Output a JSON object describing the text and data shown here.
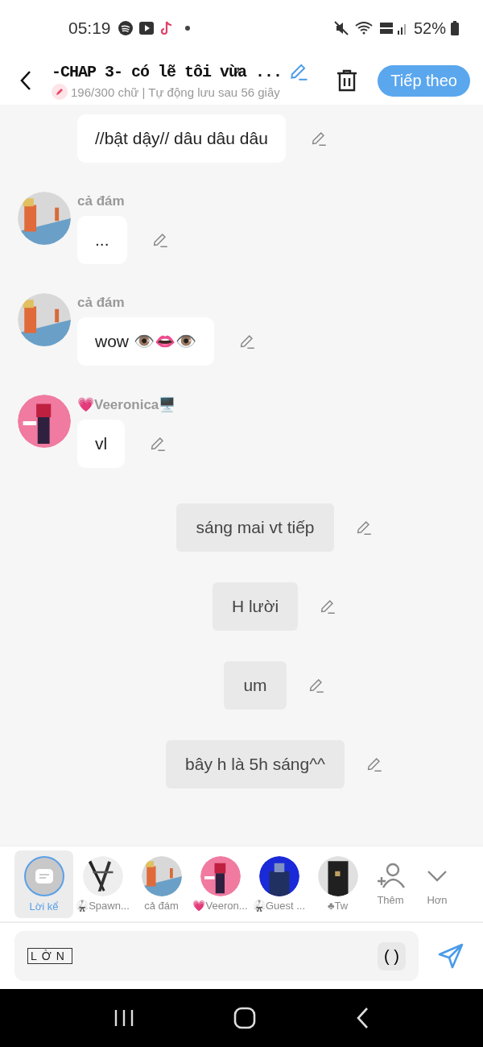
{
  "status_bar": {
    "time": "05:19",
    "battery": "52%"
  },
  "header": {
    "title": "-CHAP 3- có lẽ tôi vừa ...",
    "subtitle": "196/300 chữ | Tự động lưu sau 56 giây",
    "next_button": "Tiếp theo"
  },
  "messages": [
    {
      "kind": "character",
      "text": "//bật dậy// dâu dâu dâu"
    },
    {
      "kind": "character",
      "name": "cả đám",
      "text": "...",
      "avatar": {
        "kind": "hallway"
      }
    },
    {
      "kind": "character",
      "name": "cả đám",
      "text": "wow  👁️👄👁️",
      "avatar": {
        "kind": "hallway"
      }
    },
    {
      "kind": "character",
      "name": "💗Veeronica🖥️",
      "text": "vl",
      "avatar": {
        "kind": "pink"
      }
    },
    {
      "kind": "narration",
      "text": "sáng mai vt tiếp"
    },
    {
      "kind": "narration",
      "text": "H lười"
    },
    {
      "kind": "narration",
      "text": "um"
    },
    {
      "kind": "narration",
      "text": "bây h là 5h sáng^^"
    }
  ],
  "characters": [
    {
      "kind": "narrator",
      "label": "Lời kể",
      "selected": true
    },
    {
      "kind": "sketch",
      "label": "🥋Spawn...",
      "selected": false
    },
    {
      "kind": "hallway",
      "label": "cả đám",
      "selected": false
    },
    {
      "kind": "pink",
      "label": "💗Veeron...",
      "selected": false
    },
    {
      "kind": "blue",
      "label": "🥋Guest ...",
      "selected": false
    },
    {
      "kind": "dark",
      "label": "♣Tw",
      "selected": false
    }
  ],
  "add_button": "Thêm",
  "more_button": "Hơn",
  "input": {
    "value": "LỜN",
    "brackets_button": "( )"
  }
}
